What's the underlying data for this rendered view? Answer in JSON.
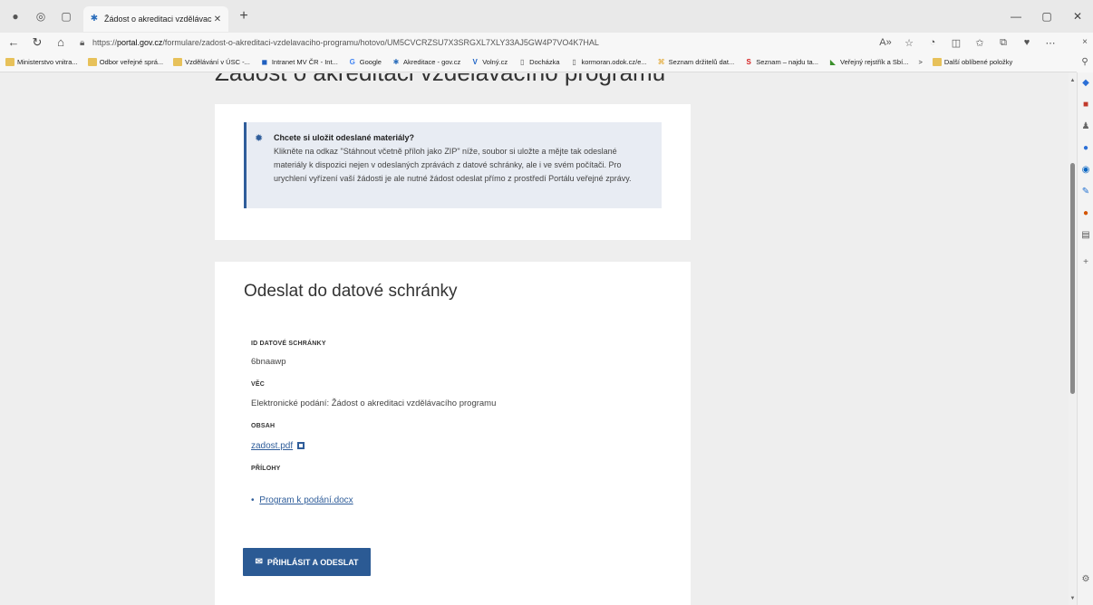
{
  "browser": {
    "tab_title": "Žádost o akreditaci vzdělávacího",
    "url_prefix": "https://",
    "url_host": "portal.gov.cz",
    "url_path": "/formulare/zadost-o-akreditaci-vzdelavaciho-programu/hotovo/UM5CVCRZSU7X3SRGXL7XLY33AJ5GW4P7VO4K7HAL",
    "bookmarks": [
      "Ministerstvo vnitra...",
      "Odbor veřejné sprá...",
      "Vzdělávání v ÚSC -...",
      "Intranet MV ČR - Int...",
      "Google",
      "Akreditace - gov.cz",
      "Volný.cz",
      "Docházka",
      "kormoran.odok.cz/e...",
      "Seznam držitelů dat...",
      "Seznam – najdu ta...",
      "Veřejný rejstřík a Sbí..."
    ],
    "bookmarks_overflow": ">",
    "other_favorites": "Další oblíbené položky"
  },
  "page": {
    "heading": "Žádost o akreditaci vzdělávacího programu",
    "info": {
      "title": "Chcete si uložit odeslané materiály?",
      "text": "Klikněte na odkaz \"Stáhnout včetně příloh jako ZIP\" níže, soubor si uložte a mějte tak odeslané materiály k dispozici nejen v odeslaných zprávách z datové schránky, ale i ve svém počítači. Pro urychlení vyřízení vaší žádosti je ale nutné žádost odeslat přímo z prostředí Portálu veřejné zprávy."
    },
    "send": {
      "title": "Odeslat do datové schránky",
      "box_id_label": "ID DATOVÉ SCHRÁNKY",
      "box_id_value": "6bnaawp",
      "subject_label": "VĚC",
      "subject_value": "Elektronické podání: Žádost o akreditaci vzdělávacího programu",
      "content_label": "OBSAH",
      "content_file": "zadost.pdf",
      "attachments_label": "PŘÍLOHY",
      "attachment_file": "Program k podání.docx",
      "submit_label": "PŘIHLÁSIT A ODESLAT"
    }
  },
  "colors": {
    "primary": "#2b5a94",
    "info_bg": "#e8ecf3",
    "page_bg": "#eeeeee"
  }
}
